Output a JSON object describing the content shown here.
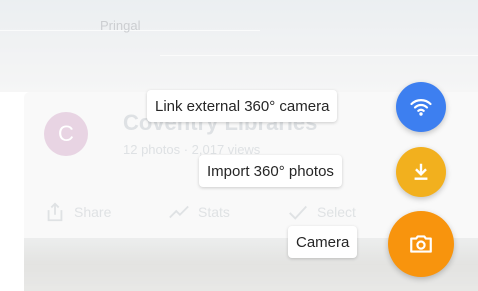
{
  "background": {
    "place_label": "Pringal",
    "album": {
      "avatar_letter": "C",
      "title": "Coventry Libraries",
      "subtitle": "12 photos · 2,017 views"
    },
    "actions": [
      {
        "label": "Share",
        "icon": "share-icon"
      },
      {
        "label": "Stats",
        "icon": "stats-icon"
      },
      {
        "label": "Select",
        "icon": "check-icon"
      }
    ]
  },
  "speed_dial": {
    "items": [
      {
        "label": "Link external 360° camera",
        "icon": "wifi-icon",
        "color": "#3d7ff0"
      },
      {
        "label": "Import 360° photos",
        "icon": "download-icon",
        "color": "#f2b01e"
      },
      {
        "label": "Camera",
        "icon": "camera-icon",
        "color": "#f8940d"
      }
    ]
  },
  "colors": {
    "scrim": "rgba(255,255,255,0.42)",
    "label_bg": "#ffffff",
    "label_text": "#262626"
  }
}
